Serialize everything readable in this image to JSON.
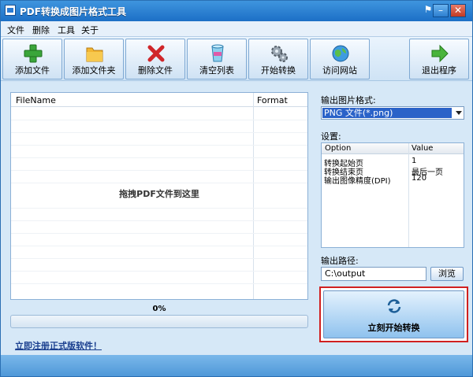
{
  "window": {
    "title": "PDF转换成图片格式工具"
  },
  "menu": {
    "items": [
      "文件",
      "删除",
      "工具",
      "关于"
    ]
  },
  "toolbar": {
    "buttons": [
      {
        "label": "添加文件",
        "icon": "plus-icon"
      },
      {
        "label": "添加文件夹",
        "icon": "folder-icon"
      },
      {
        "label": "删除文件",
        "icon": "delete-x-icon"
      },
      {
        "label": "清空列表",
        "icon": "clear-list-icon"
      },
      {
        "label": "开始转换",
        "icon": "gears-icon"
      },
      {
        "label": "访问网站",
        "icon": "globe-icon"
      },
      {
        "label": "退出程序",
        "icon": "exit-arrow-icon"
      }
    ]
  },
  "file_list": {
    "columns": [
      "FileName",
      "Format"
    ],
    "drop_hint": "拖拽PDF文件到这里"
  },
  "progress": {
    "label": "0%",
    "value": 0
  },
  "register_link": "立即注册正式版软件！",
  "output_format": {
    "label": "输出图片格式:",
    "selected": "PNG 文件(*.png)"
  },
  "settings": {
    "label": "设置:",
    "headers": [
      "Option",
      "Value"
    ],
    "rows": [
      {
        "option": "转换起始页",
        "value": "1"
      },
      {
        "option": "转换结束页",
        "value": "最后一页"
      },
      {
        "option": "输出图像精度(DPI)",
        "value": "120"
      }
    ]
  },
  "output_path": {
    "label": "输出路径:",
    "value": "C:\\output",
    "browse_label": "浏览"
  },
  "convert_button": {
    "label": "立刻开始转换"
  },
  "colors": {
    "accent_red": "#d02020",
    "titlebar_blue": "#1c6fc6"
  }
}
